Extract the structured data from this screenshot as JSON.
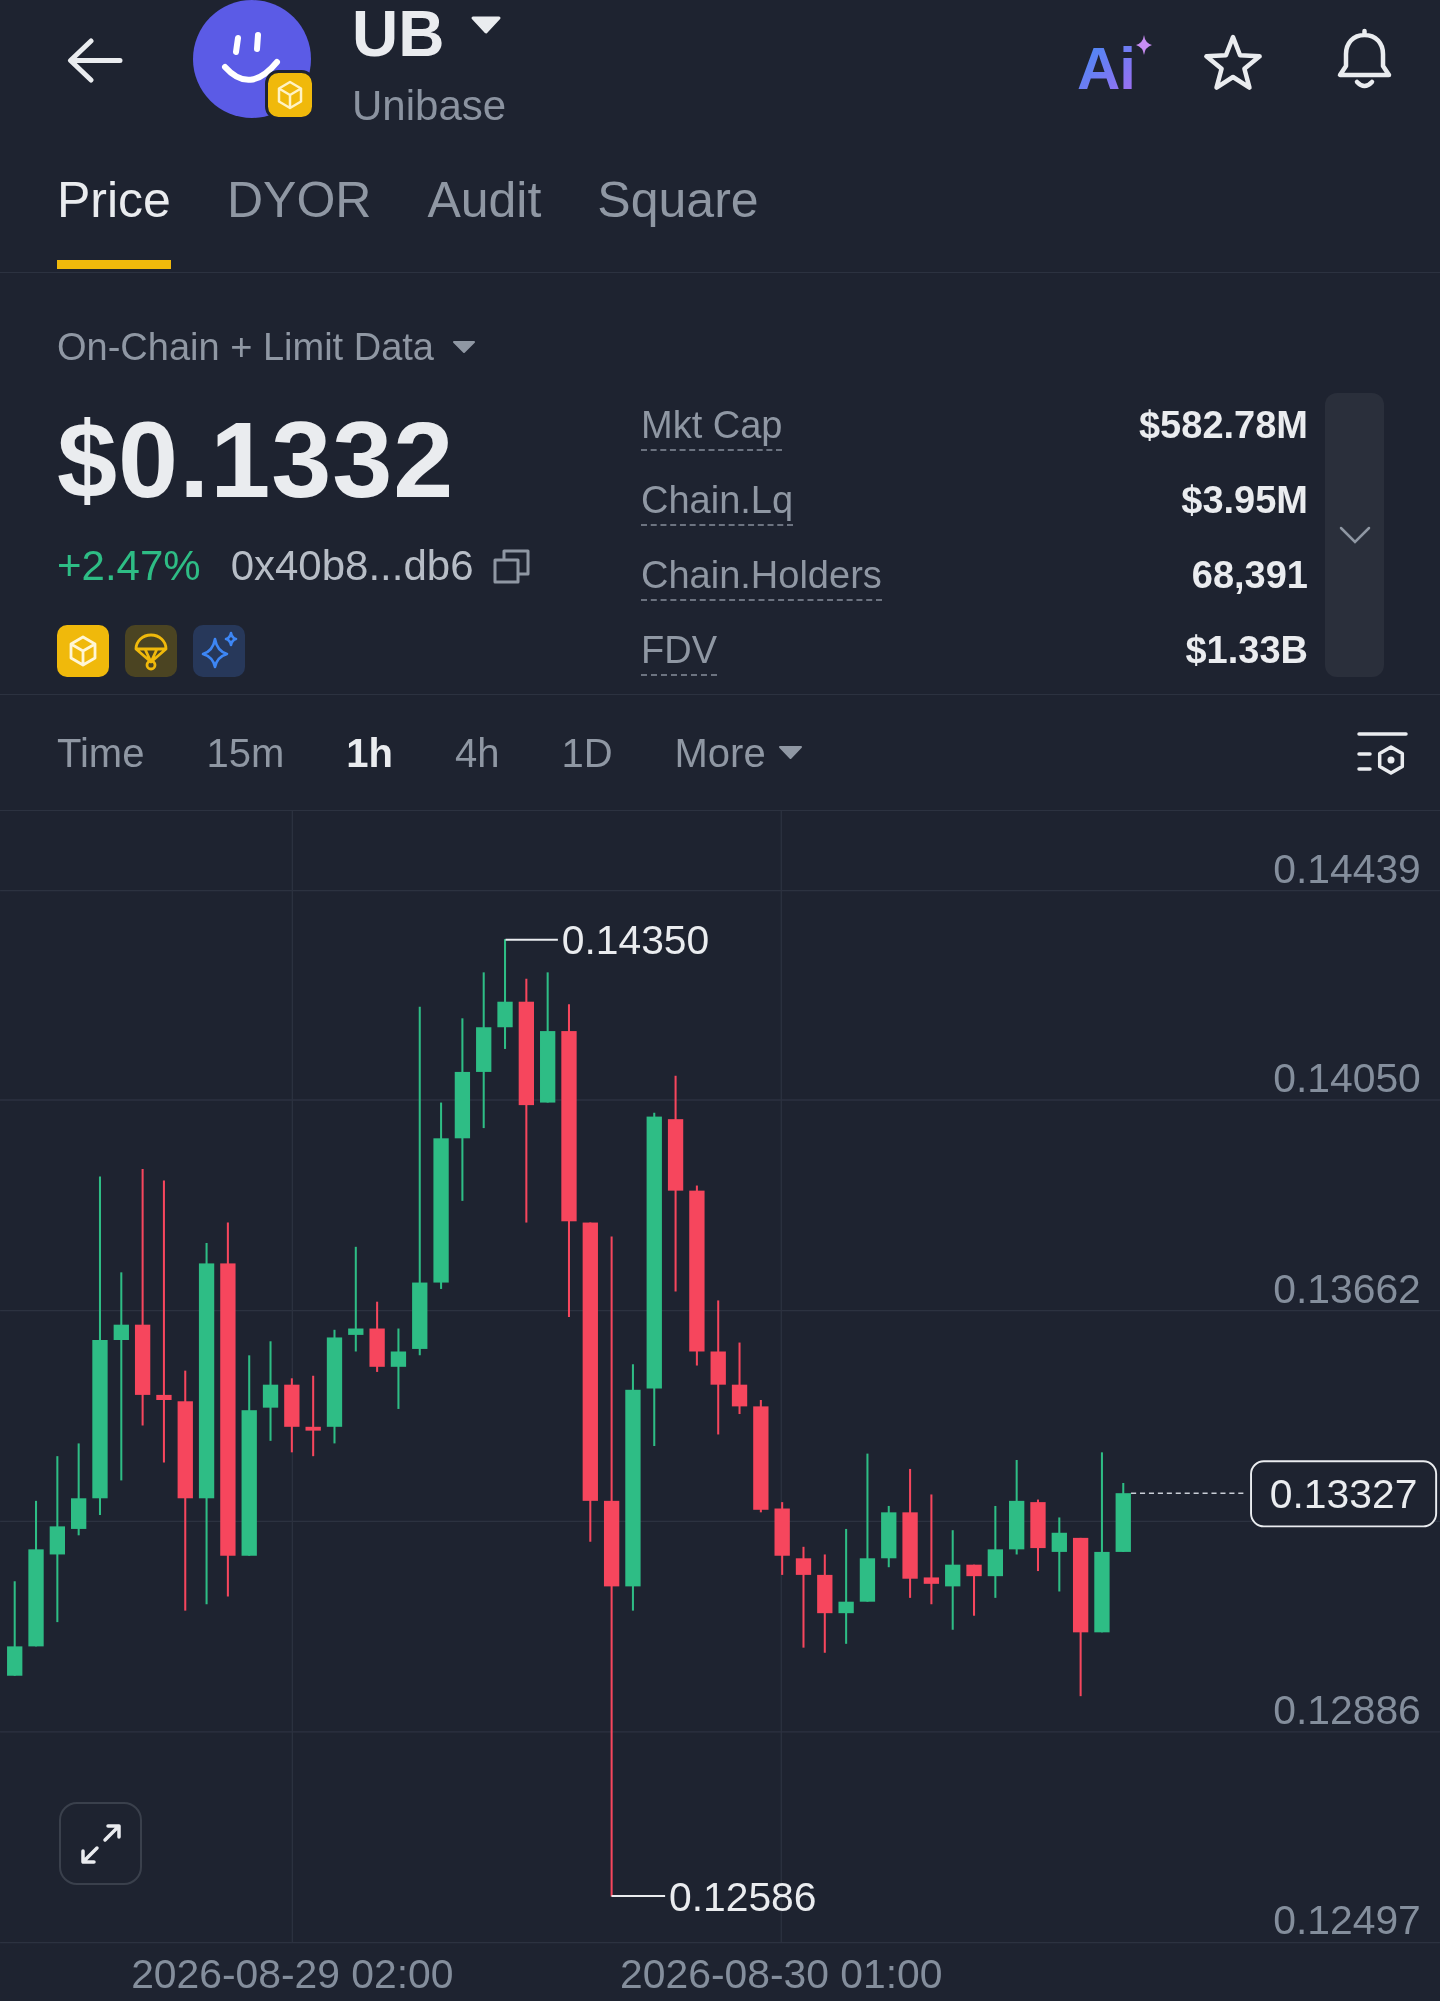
{
  "header": {
    "token_symbol": "UB",
    "token_name": "Unibase",
    "ai_label": "Ai"
  },
  "tabs": [
    {
      "label": "Price",
      "selected": true
    },
    {
      "label": "DYOR",
      "selected": false
    },
    {
      "label": "Audit",
      "selected": false
    },
    {
      "label": "Square",
      "selected": false
    }
  ],
  "overview": {
    "data_source": "On-Chain + Limit Data",
    "price": "$0.1332",
    "change": "+2.47%",
    "contract": "0x40b8...db6",
    "stats": [
      {
        "label": "Mkt Cap",
        "value": "$582.78M"
      },
      {
        "label": "Chain.Lq",
        "value": "$3.95M"
      },
      {
        "label": "Chain.Holders",
        "value": "68,391"
      },
      {
        "label": "FDV",
        "value": "$1.33B"
      }
    ]
  },
  "intervals": [
    {
      "label": "Time",
      "kind": "option",
      "selected": false
    },
    {
      "label": "15m",
      "kind": "option",
      "selected": false
    },
    {
      "label": "1h",
      "kind": "option",
      "selected": true
    },
    {
      "label": "4h",
      "kind": "option",
      "selected": false
    },
    {
      "label": "1D",
      "kind": "option",
      "selected": false
    },
    {
      "label": "More",
      "kind": "dropdown",
      "selected": false
    }
  ],
  "chart": {
    "price_labels": [
      "0.14439",
      "0.14050",
      "0.13662",
      "0.12886",
      "0.12497"
    ],
    "high_label": "0.14350",
    "low_label": "0.12586",
    "last_price": "0.13327",
    "date_labels": [
      "2026-08-29 02:00",
      "2026-08-30 01:00"
    ]
  }
}
